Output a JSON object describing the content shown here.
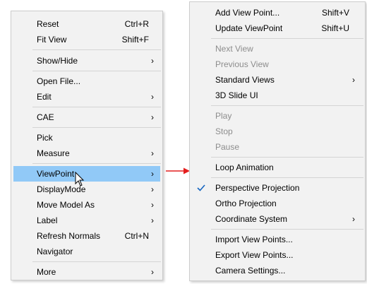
{
  "menu1": {
    "items": [
      {
        "label": "Reset",
        "shortcut": "Ctrl+R",
        "submenu": false
      },
      {
        "label": "Fit View",
        "shortcut": "Shift+F",
        "submenu": false
      },
      {
        "label": "Show/Hide",
        "shortcut": "",
        "submenu": true
      },
      {
        "label": "Open File...",
        "shortcut": "",
        "submenu": false
      },
      {
        "label": "Edit",
        "shortcut": "",
        "submenu": true
      },
      {
        "label": "CAE",
        "shortcut": "",
        "submenu": true
      },
      {
        "label": "Pick",
        "shortcut": "",
        "submenu": false
      },
      {
        "label": "Measure",
        "shortcut": "",
        "submenu": true
      },
      {
        "label": "ViewPoint",
        "shortcut": "",
        "submenu": true
      },
      {
        "label": "DisplayMode",
        "shortcut": "",
        "submenu": true
      },
      {
        "label": "Move Model As",
        "shortcut": "",
        "submenu": true
      },
      {
        "label": "Label",
        "shortcut": "",
        "submenu": true
      },
      {
        "label": "Refresh Normals",
        "shortcut": "Ctrl+N",
        "submenu": false
      },
      {
        "label": "Navigator",
        "shortcut": "",
        "submenu": false
      },
      {
        "label": "More",
        "shortcut": "",
        "submenu": true
      }
    ]
  },
  "menu2": {
    "items": [
      {
        "label": "Add View Point...",
        "shortcut": "Shift+V"
      },
      {
        "label": "Update ViewPoint",
        "shortcut": "Shift+U"
      },
      {
        "label": "Next View",
        "shortcut": ""
      },
      {
        "label": "Previous View",
        "shortcut": ""
      },
      {
        "label": "Standard Views",
        "shortcut": ""
      },
      {
        "label": "3D Slide UI",
        "shortcut": ""
      },
      {
        "label": "Play",
        "shortcut": ""
      },
      {
        "label": "Stop",
        "shortcut": ""
      },
      {
        "label": "Pause",
        "shortcut": ""
      },
      {
        "label": "Loop Animation",
        "shortcut": ""
      },
      {
        "label": "Perspective Projection",
        "shortcut": ""
      },
      {
        "label": "Ortho Projection",
        "shortcut": ""
      },
      {
        "label": "Coordinate System",
        "shortcut": ""
      },
      {
        "label": "Import View Points...",
        "shortcut": ""
      },
      {
        "label": "Export View Points...",
        "shortcut": ""
      },
      {
        "label": "Camera Settings...",
        "shortcut": ""
      }
    ]
  },
  "icons": {
    "submenu_arrow": "chevron-right-icon",
    "check": "checkmark-icon",
    "cursor": "mouse-pointer-icon",
    "connector": "red-arrow-icon"
  },
  "colors": {
    "menu_bg": "#f2f2f2",
    "highlight": "#91c9f7",
    "disabled_text": "#8d8d8d",
    "check": "#1565c0",
    "connector_arrow": "#e41e1e"
  }
}
